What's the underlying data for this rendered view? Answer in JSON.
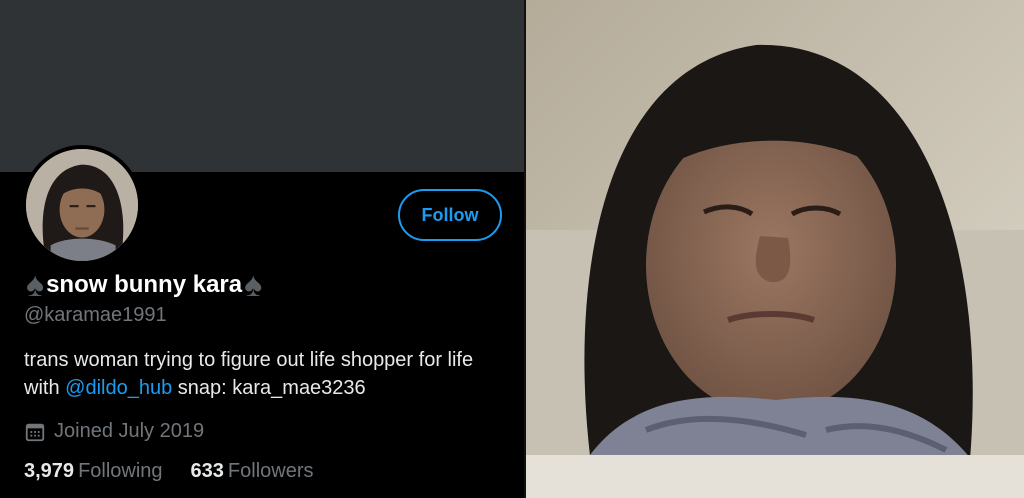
{
  "profile": {
    "display_name": "snow bunny kara",
    "spade_glyph": "♠",
    "handle": "@karamae1991",
    "follow_label": "Follow",
    "bio_text_1": "trans woman trying to figure out life shopper for life with",
    "bio_mention": "@dildo_hub",
    "bio_text_2": "snap: kara_mae3236",
    "joined": "Joined July 2019",
    "following_count": "3,979",
    "following_label": "Following",
    "followers_count": "633",
    "followers_label": "Followers"
  },
  "colors": {
    "accent": "#1d9bf0",
    "banner": "#2f3336",
    "muted_text": "#71767b"
  },
  "icons": {
    "calendar": "calendar-icon",
    "spade": "spade-icon"
  }
}
